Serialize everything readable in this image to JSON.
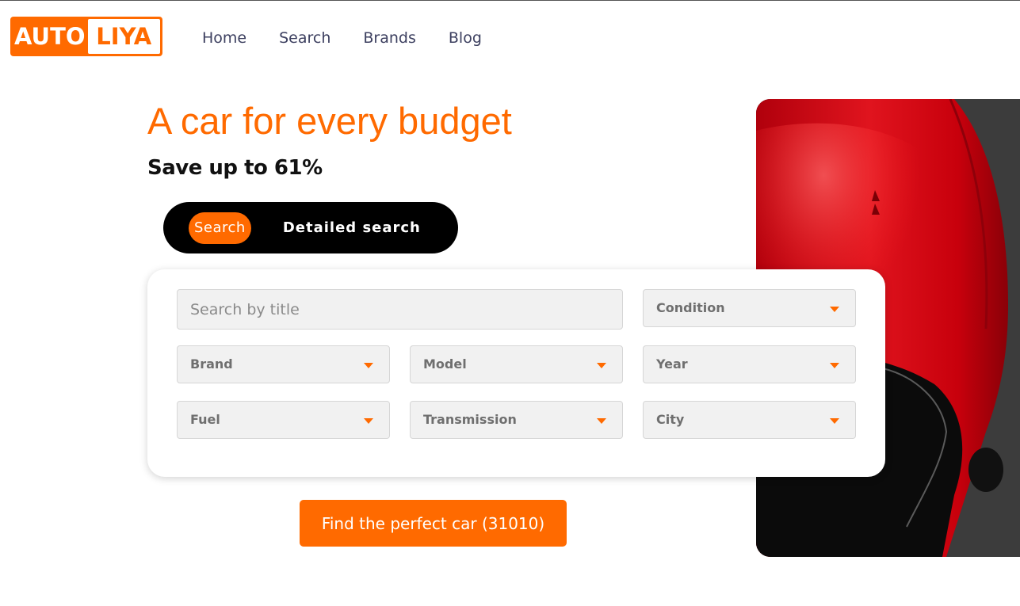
{
  "brand": {
    "logo_left": "AUTO",
    "logo_right": "LIYA",
    "accent_color": "#ff6a00"
  },
  "nav": {
    "items": [
      {
        "label": "Home"
      },
      {
        "label": "Search"
      },
      {
        "label": "Brands"
      },
      {
        "label": "Blog"
      }
    ]
  },
  "hero": {
    "title": "A car for every budget",
    "subtitle": "Save up to 61%"
  },
  "tabs": {
    "active": "Search",
    "other": "Detailed search"
  },
  "search": {
    "title_placeholder": "Search by title",
    "title_value": "",
    "selects": {
      "condition": "Condition",
      "brand": "Brand",
      "model": "Model",
      "year": "Year",
      "fuel": "Fuel",
      "transmission": "Transmission",
      "city": "City"
    }
  },
  "cta": {
    "label": "Find the perfect car (31010)"
  },
  "image": {
    "subject": "red-car-top-view"
  }
}
